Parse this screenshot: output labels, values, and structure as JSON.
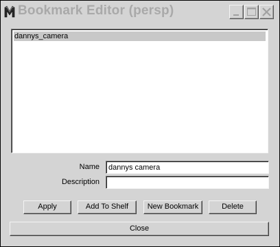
{
  "window": {
    "title": "Bookmark Editor (persp)",
    "icon": "maya-logo-icon",
    "controls": [
      "minimize-icon",
      "maximize-icon",
      "close-icon"
    ]
  },
  "bookmarks": {
    "items": [
      {
        "label": "dannys_camera",
        "selected": true
      }
    ]
  },
  "form": {
    "name_label": "Name",
    "name_value": "dannys camera",
    "description_label": "Description",
    "description_value": ""
  },
  "buttons": {
    "apply": "Apply",
    "add_to_shelf": "Add To Shelf",
    "new_bookmark": "New Bookmark",
    "delete": "Delete",
    "close": "Close"
  }
}
